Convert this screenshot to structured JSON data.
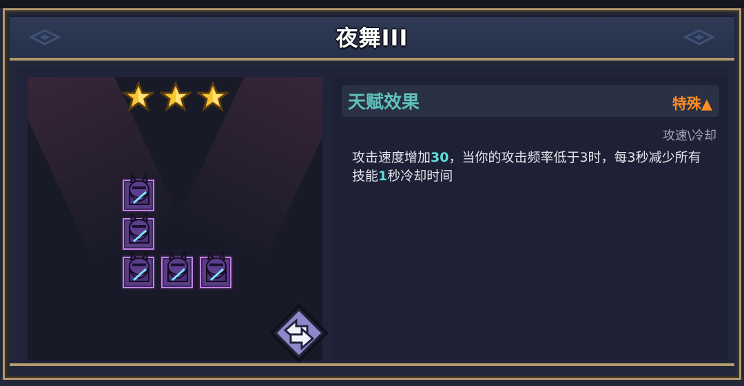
{
  "title": "夜舞III",
  "stars": {
    "filled": 3,
    "total": 3
  },
  "effect": {
    "header": "天赋效果",
    "special_label": "特殊▲",
    "category": "攻速\\冷却",
    "desc_part1": "攻击速度增加",
    "desc_value1": "30",
    "desc_part2": "，当你的攻击频率低于3时，每3秒减少所有技能",
    "desc_value2": "1",
    "desc_part3": "秒冷却时间"
  },
  "formation": {
    "unit": "dark-knight-icon",
    "cells": [
      [
        0,
        0
      ],
      [
        0,
        1
      ],
      [
        0,
        2
      ],
      [
        1,
        2
      ],
      [
        2,
        2
      ]
    ]
  },
  "colors": {
    "accent_teal": "#5fc3bb",
    "accent_orange": "#ff8c23",
    "highlight_cyan": "#5fe0dc",
    "tile_border": "#c382e6",
    "frame_gold": "#b39a6d"
  }
}
